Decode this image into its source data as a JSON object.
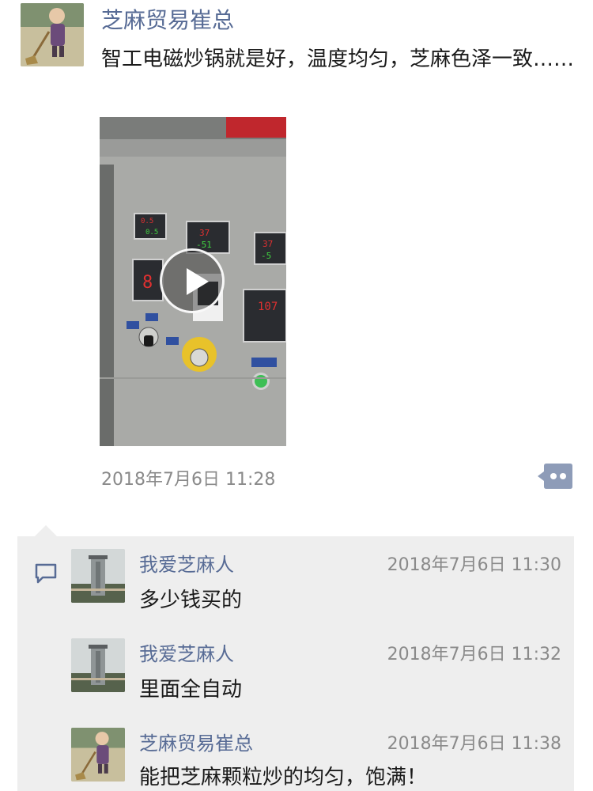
{
  "post": {
    "author": "芝麻贸易崔总",
    "text": "智工电磁炒锅就是好，温度均匀，芝麻色泽一致……",
    "time": "2018年7月6日 11:28",
    "media": {
      "type": "video",
      "control_panel_readouts": [
        "0.5",
        "37",
        "-51",
        "37",
        "-5",
        "8",
        "107"
      ]
    },
    "more_icon": "ellipsis-icon"
  },
  "comments": {
    "icon": "comment-bubble-icon",
    "items": [
      {
        "author": "我爱芝麻人",
        "time": "2018年7月6日 11:30",
        "text": "多少钱买的",
        "avatar": "tower-avatar"
      },
      {
        "author": "我爱芝麻人",
        "time": "2018年7月6日 11:32",
        "text": "里面全自动",
        "avatar": "tower-avatar"
      },
      {
        "author": "芝麻贸易崔总",
        "time": "2018年7月6日 11:38",
        "text": "能把芝麻颗粒炒的均匀，饱满！",
        "avatar": "monk-avatar"
      }
    ]
  },
  "colors": {
    "name_link": "#576b95",
    "body_text": "#1a1a1a",
    "timestamp": "#8a8a8a",
    "comment_background": "#eeeeee"
  }
}
